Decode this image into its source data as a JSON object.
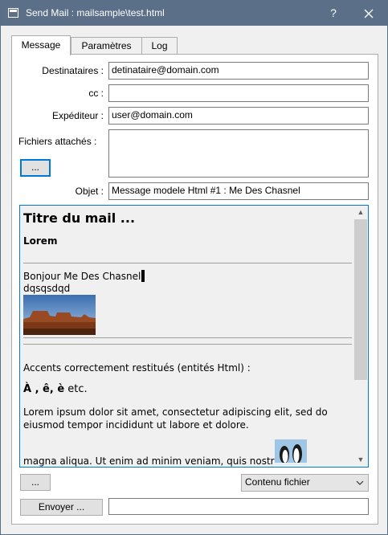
{
  "window": {
    "title": "Send Mail : mailsample\\test.html",
    "help_label": "?",
    "colors": {
      "titlebar": "#5b7088",
      "accent": "#0078d7"
    }
  },
  "tabs": [
    {
      "label": "Message",
      "active": true
    },
    {
      "label": "Paramètres",
      "active": false
    },
    {
      "label": "Log",
      "active": false
    }
  ],
  "form": {
    "to_label": "Destinataires :",
    "to_value": "detinataire@domain.com",
    "cc_label": "cc :",
    "cc_value": "",
    "from_label": "Expéditeur :",
    "from_value": "user@domain.com",
    "attachments_label": "Fichiers attachés :",
    "attach_button_label": "...",
    "subject_label": "Objet :",
    "subject_value": "Message modele Html #1 : Me Des Chasnel"
  },
  "body": {
    "title": "Titre du mail ...",
    "subtitle": "Lorem",
    "greeting": "Bonjour Me Des Chasnel,",
    "line2": "dqsqsdqd",
    "accents_line": "Accents correctement restitués (entités Html) :",
    "accents_bold": "À , ê, è",
    "accents_suffix": " etc.",
    "para1_line1": "Lorem ipsum dolor sit amet, consectetur adipiscing elit, sed do",
    "para1_line2": "eiusmod tempor incididunt ut labore et dolore.",
    "para2_line1": "magna aliqua. Ut enim ad minim veniam, quis nostrud",
    "image1": "desert-landscape-image",
    "image2": "penguins-image"
  },
  "footer": {
    "more_button_label": "...",
    "source_select_value": "Contenu fichier",
    "send_button_label": "Envoyer ...",
    "status_value": ""
  }
}
